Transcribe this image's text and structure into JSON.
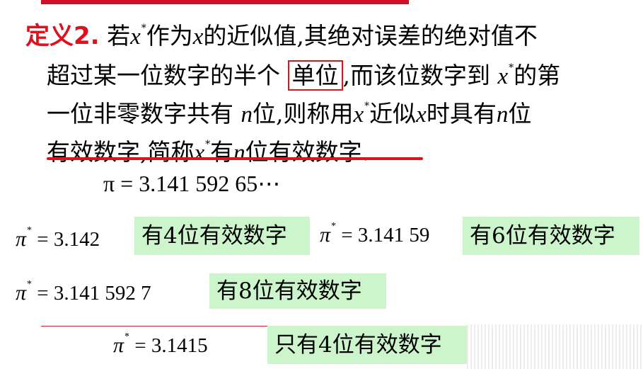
{
  "definition": {
    "title": "定义2.",
    "line1_a": "若",
    "line1_b": "作为",
    "line1_c": "的近似值",
    "line1_d": "其绝对误差的绝对值不",
    "line2_a": "超过某一位数字的半个",
    "line2_boxed": "单位",
    "line2_b": "而该位数字到",
    "line2_c": "的第",
    "line3_a": "一位非零数字共有",
    "line3_b": "位",
    "line3_c": "则称用",
    "line3_d": "近似",
    "line3_e": "时具有",
    "line3_f": "位",
    "line4_a": "有效数字",
    "line4_b": "简称",
    "line4_c": "有",
    "line4_d": "位有效数字",
    "var_x": "x",
    "var_n": "n",
    "star": "*",
    "comma": ",",
    "period": "."
  },
  "pi_value": "π = 3.141 592 65⋯",
  "examples": [
    {
      "lhs": "π",
      "star": "*",
      "rhs": "= 3.142",
      "label": "有4位有效数字"
    },
    {
      "lhs": "π",
      "star": "*",
      "rhs": "= 3.141 59",
      "label": "有6位有效数字"
    },
    {
      "lhs": "π",
      "star": "*",
      "rhs": "= 3.141 592 7",
      "label": "有8位有效数字"
    },
    {
      "lhs": "π",
      "star": "*",
      "rhs": "= 3.1415",
      "label": "只有4位有效数字"
    }
  ],
  "colors": {
    "accent_red": "#e0101e",
    "highlight_green": "#ccf5cc"
  }
}
